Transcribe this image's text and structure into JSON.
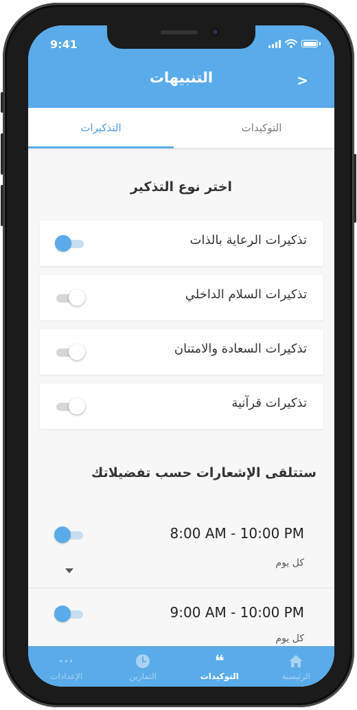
{
  "status_bar": {
    "time": "9:41"
  },
  "header": {
    "title": "التنبيهات",
    "back_icon": "chevron-right-icon",
    "back_glyph": ">"
  },
  "tabs": [
    {
      "label": "التوكيدات",
      "active": false
    },
    {
      "label": "التذكيرات",
      "active": true
    }
  ],
  "reminder_types": {
    "title": "اختر نوع التذكير",
    "items": [
      {
        "label": "تذكيرات الرعاية بالذات",
        "enabled": true
      },
      {
        "label": "تذكيرات السلام الداخلي",
        "enabled": false
      },
      {
        "label": "تذكيرات السعادة والامتنان",
        "enabled": false
      },
      {
        "label": "تذكيرات قرآنية",
        "enabled": false
      }
    ]
  },
  "schedule": {
    "title": "ستتلقى الإشعارات حسب تفضيلاتك",
    "items": [
      {
        "time": "8:00 AM - 10:00 PM",
        "days": "كل يوم",
        "enabled": true
      },
      {
        "time": "9:00 AM - 10:00 PM",
        "days": "كل يوم",
        "enabled": true
      }
    ]
  },
  "tab_bar": [
    {
      "label": "الإعدادات",
      "icon": "more-dots-icon",
      "glyph": "•••",
      "active": false
    },
    {
      "label": "التمارين",
      "icon": "clock-icon",
      "glyph": "",
      "active": false
    },
    {
      "label": "التوكيدات",
      "icon": "quote-icon",
      "glyph": "❝",
      "active": true
    },
    {
      "label": "الرئيسية",
      "icon": "home-icon",
      "glyph": "",
      "active": false
    }
  ],
  "colors": {
    "accent": "#5aabe9",
    "toggle_on": "#5aabe9",
    "toggle_off": "#d6d6d6"
  }
}
